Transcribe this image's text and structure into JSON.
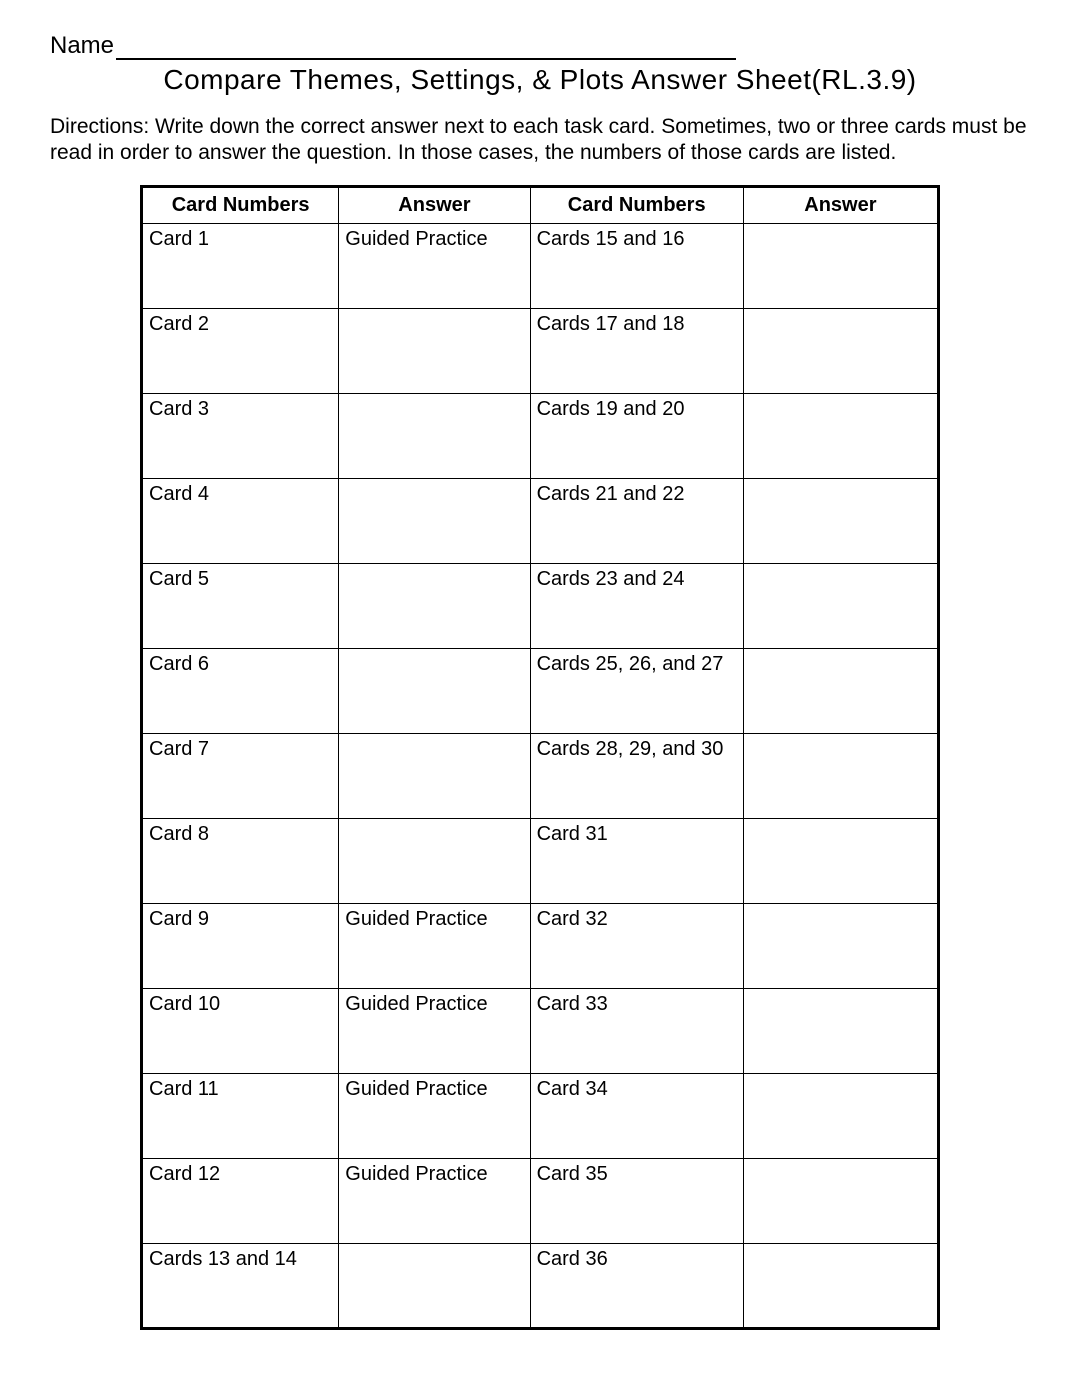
{
  "name_label": "Name",
  "title": "Compare Themes, Settings, & Plots Answer Sheet(RL.3.9)",
  "directions": "Directions:  Write down the correct answer next to each task card.  Sometimes, two or three cards must be read in order to answer the question.  In those cases, the numbers of those cards are listed.",
  "headers": {
    "col1": "Card Numbers",
    "col2": "Answer",
    "col3": "Card Numbers",
    "col4": "Answer"
  },
  "rows": [
    {
      "c1": "Card 1",
      "a1": "Guided Practice",
      "c2": "Cards 15 and 16",
      "a2": ""
    },
    {
      "c1": "Card 2",
      "a1": "",
      "c2": "Cards 17 and 18",
      "a2": ""
    },
    {
      "c1": "Card 3",
      "a1": "",
      "c2": "Cards 19 and 20",
      "a2": ""
    },
    {
      "c1": "Card 4",
      "a1": "",
      "c2": "Cards 21 and 22",
      "a2": ""
    },
    {
      "c1": "Card 5",
      "a1": "",
      "c2": "Cards 23 and 24",
      "a2": ""
    },
    {
      "c1": "Card 6",
      "a1": "",
      "c2": "Cards 25, 26, and 27",
      "a2": ""
    },
    {
      "c1": "Card 7",
      "a1": "",
      "c2": "Cards 28, 29, and 30",
      "a2": ""
    },
    {
      "c1": "Card 8",
      "a1": "",
      "c2": "Card 31",
      "a2": ""
    },
    {
      "c1": "Card 9",
      "a1": "Guided Practice",
      "c2": "Card 32",
      "a2": ""
    },
    {
      "c1": "Card 10",
      "a1": "Guided Practice",
      "c2": "Card 33",
      "a2": ""
    },
    {
      "c1": "Card 11",
      "a1": "Guided Practice",
      "c2": "Card 34",
      "a2": ""
    },
    {
      "c1": "Card 12",
      "a1": "Guided Practice",
      "c2": "Card 35",
      "a2": ""
    },
    {
      "c1": "Cards 13 and 14",
      "a1": "",
      "c2": "Card 36",
      "a2": ""
    }
  ]
}
